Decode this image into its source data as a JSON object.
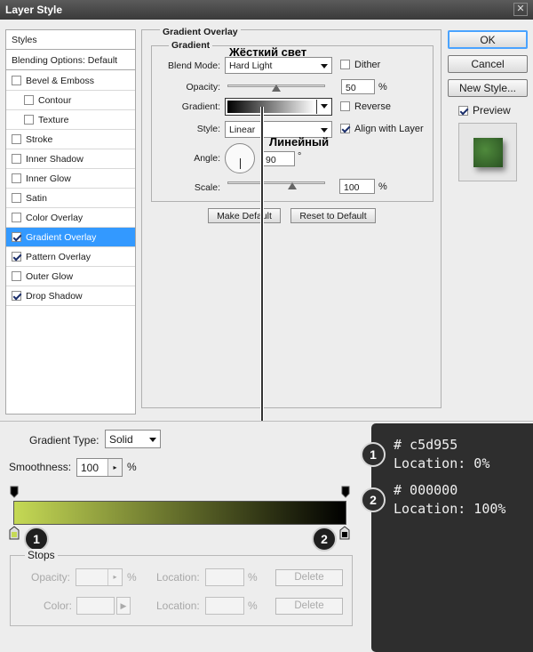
{
  "window": {
    "title": "Layer Style"
  },
  "styles_list": {
    "header": "Styles",
    "blending": "Blending Options: Default",
    "items": [
      {
        "label": "Bevel & Emboss",
        "checked": false
      },
      {
        "label": "Contour",
        "checked": false
      },
      {
        "label": "Texture",
        "checked": false
      },
      {
        "label": "Stroke",
        "checked": false
      },
      {
        "label": "Inner Shadow",
        "checked": false
      },
      {
        "label": "Inner Glow",
        "checked": false
      },
      {
        "label": "Satin",
        "checked": false
      },
      {
        "label": "Color Overlay",
        "checked": false
      },
      {
        "label": "Gradient Overlay",
        "checked": true
      },
      {
        "label": "Pattern Overlay",
        "checked": true
      },
      {
        "label": "Outer Glow",
        "checked": false
      },
      {
        "label": "Drop Shadow",
        "checked": true
      }
    ]
  },
  "panel": {
    "title": "Gradient Overlay",
    "group_title": "Gradient",
    "blend_mode_label": "Blend Mode:",
    "blend_mode_value": "Hard Light",
    "dither_label": "Dither",
    "opacity_label": "Opacity:",
    "opacity_value": "50",
    "opacity_value_pct": 50,
    "pct": "%",
    "gradient_label": "Gradient:",
    "reverse_label": "Reverse",
    "style_label": "Style:",
    "style_value": "Linear",
    "align_label": "Align with Layer",
    "angle_label": "Angle:",
    "angle_value": "90",
    "degree": "°",
    "scale_label": "Scale:",
    "scale_value": "100",
    "scale_value_pct": 100,
    "make_default": "Make Default",
    "reset_default": "Reset to Default",
    "annot_blend": "Жёсткий свет",
    "annot_style": "Линейный"
  },
  "right": {
    "ok": "OK",
    "cancel": "Cancel",
    "new_style": "New Style...",
    "preview_label": "Preview",
    "preview_checked": true
  },
  "editor": {
    "gradient_type_label": "Gradient Type:",
    "gradient_type_value": "Solid",
    "smoothness_label": "Smoothness:",
    "smoothness_value": "100",
    "pct": "%",
    "stops_title": "Stops",
    "opacity_label": "Opacity:",
    "color_label": "Color:",
    "location_label": "Location:",
    "delete_label": "Delete",
    "badge_1": "1",
    "badge_2": "2",
    "colors": {
      "start": "#c5d955",
      "end": "#000000"
    }
  },
  "annotations": {
    "stop1": {
      "badge": "1",
      "color": "# c5d955",
      "location": "Location: 0%"
    },
    "stop2": {
      "badge": "2",
      "color": "# 000000",
      "location": "Location: 100%"
    }
  }
}
